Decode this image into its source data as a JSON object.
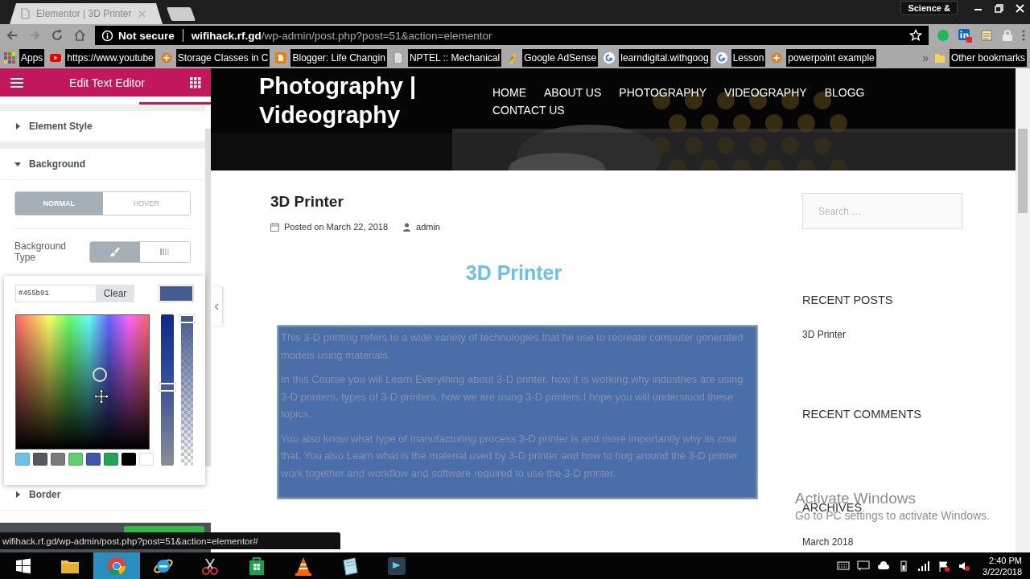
{
  "browser": {
    "tabs": [
      {
        "title": "Elementor | 3D Printer",
        "selected": true
      }
    ],
    "profile": "Science &",
    "address": {
      "security": "Not secure",
      "host": "wifihack.rf.gd",
      "path": "/wp-admin/post.php?post=51&action=elementor"
    },
    "bookmarks": [
      {
        "label": "Apps",
        "kind": "apps"
      },
      {
        "label": "https://www.youtube",
        "kind": "youtube"
      },
      {
        "label": "Storage Classes in C",
        "kind": "site"
      },
      {
        "label": "Blogger: Life Changin",
        "kind": "blogger"
      },
      {
        "label": "NPTEL :: Mechanical",
        "kind": "page"
      },
      {
        "label": "Google AdSense",
        "kind": "adsense"
      },
      {
        "label": "learndigital.withgoog",
        "kind": "google"
      },
      {
        "label": "Lesson",
        "kind": "google"
      },
      {
        "label": "powerpoint example",
        "kind": "site"
      }
    ],
    "bookmarks_more": "»",
    "other_bookmarks": "Other bookmarks"
  },
  "editor": {
    "title": "Edit Text Editor",
    "sections": [
      {
        "label": "Element Style",
        "expanded": false
      },
      {
        "label": "Background",
        "expanded": true
      },
      {
        "label": "Border",
        "expanded": false
      }
    ],
    "state_tabs": [
      {
        "label": "NORMAL",
        "selected": true
      },
      {
        "label": "HOVER",
        "selected": false
      }
    ],
    "background_type": {
      "label": "Background Type",
      "options": [
        {
          "kind": "classic",
          "selected": true
        },
        {
          "kind": "gradient",
          "selected": false
        }
      ]
    },
    "color_picker": {
      "value": "#455b91",
      "hue": {
        "level": 0.48
      },
      "opacity": {
        "level": 1
      },
      "clear": "Clear",
      "swatches": [
        {
          "color": "#6ec1e4"
        },
        {
          "color": "#54595f"
        },
        {
          "color": "#7a7a7a"
        },
        {
          "color": "#61ce70"
        },
        {
          "color": "#4054b2"
        },
        {
          "color": "#23a455"
        },
        {
          "color": "#000000"
        },
        {
          "color": "#ffffff"
        }
      ]
    }
  },
  "site": {
    "title": "Photography | Videography",
    "nav": [
      "HOME",
      "ABOUT US",
      "PHOTOGRAPHY",
      "VIDEOGRAPHY",
      "BLOGG",
      "CONTACT US"
    ],
    "post": {
      "title": "3D Printer",
      "date": "Posted on March 22, 2018",
      "author": "admin",
      "heading": "3D Printer",
      "paragraphs": [
        "This 3-D printing refers to a wide variety of technologies that he use to recreate computer generated models using materials.",
        "In this Course you will Learn Everything about 3-D printer, how it is working,why industries are using 3-D printers, types of 3-D printers, how we are using 3-D printers.I hope you will understood these topics.",
        "You also know what type of manufacturing process 3-D printer is and more importantly why its cool that. You also Learn what is the material used by 3-D printer and how to hug around the 3-D printer work together and workflow and software required to use the 3-D printer."
      ]
    },
    "sidebar": {
      "search_placeholder": "Search …",
      "widgets": [
        {
          "title": "RECENT POSTS",
          "links": [
            "3D Printer"
          ]
        },
        {
          "title": "RECENT COMMENTS"
        },
        {
          "title": "ARCHIVES",
          "links": [
            "March 2018"
          ]
        }
      ]
    }
  },
  "status_url": "wifihack.rf.gd/wp-admin/post.php?post=51&action=elementor#",
  "os_notice": {
    "title": "Activate Windows",
    "text": "Go to PC settings to activate Windows."
  },
  "taskbar": {
    "apps": [
      {
        "kind": "folder",
        "selected": false
      },
      {
        "kind": "chrome",
        "selected": true
      },
      {
        "kind": "ie",
        "selected": false
      },
      {
        "kind": "scissors",
        "selected": false
      },
      {
        "kind": "store",
        "selected": false
      },
      {
        "kind": "cone",
        "selected": false
      },
      {
        "kind": "notepad",
        "selected": false
      },
      {
        "kind": "editor",
        "selected": false
      }
    ],
    "time": "2:40 PM",
    "date": "3/22/2018"
  }
}
